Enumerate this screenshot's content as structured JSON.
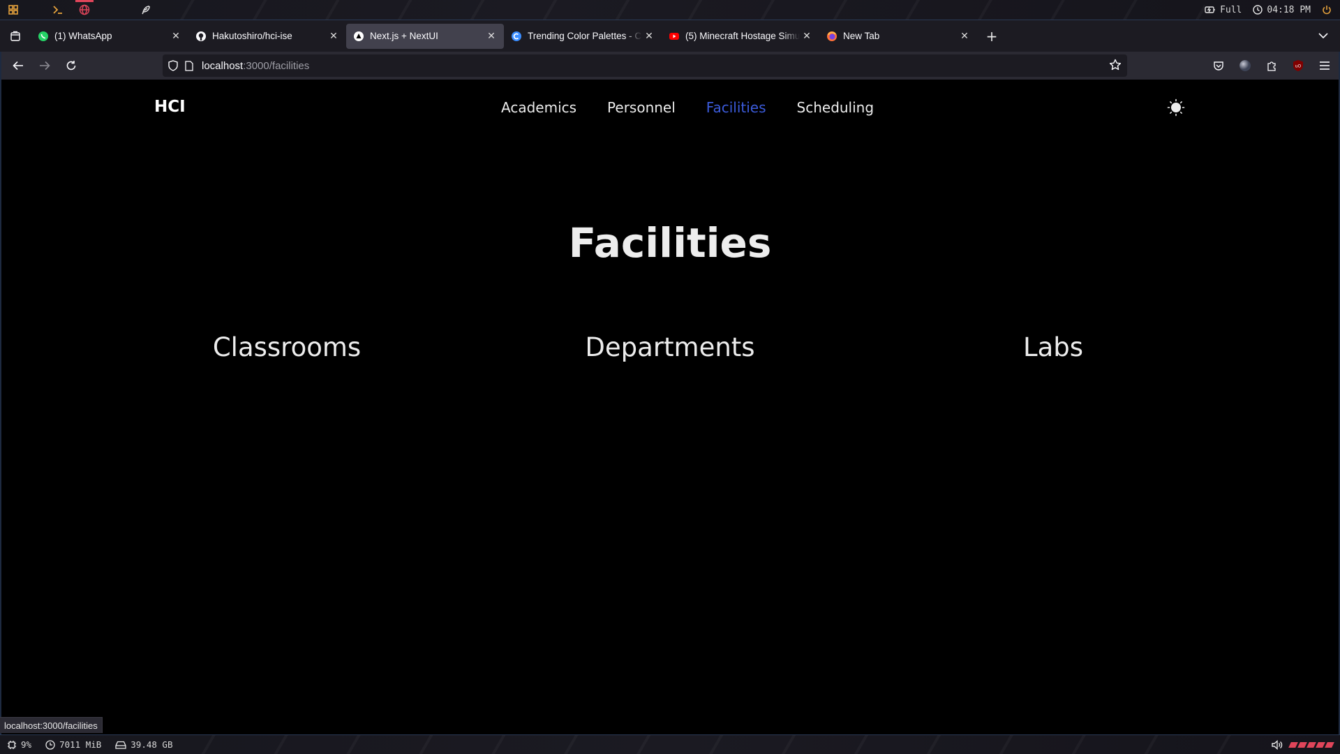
{
  "os_top": {
    "workspaces": [
      "grid",
      "terminal",
      "globe",
      "feather"
    ],
    "power_mode": "Full",
    "clock": "04:18 PM"
  },
  "browser": {
    "tabs": [
      {
        "label": "(1) WhatsApp",
        "icon": "whatsapp-icon",
        "active": false
      },
      {
        "label": "Hakutoshiro/hci-ise",
        "icon": "github-icon",
        "active": false
      },
      {
        "label": "Next.js + NextUI",
        "icon": "nextjs-icon",
        "active": true
      },
      {
        "label": "Trending Color Palettes - C",
        "icon": "coolors-icon",
        "active": false
      },
      {
        "label": "(5) Minecraft Hostage Simu",
        "icon": "youtube-icon",
        "active": false
      },
      {
        "label": "New Tab",
        "icon": "firefox-icon",
        "active": false
      }
    ],
    "url_host": "localhost",
    "url_path": ":3000/facilities",
    "status_url": "localhost:3000/facilities"
  },
  "site": {
    "brand": "HCI",
    "nav": [
      {
        "label": "Academics",
        "active": false
      },
      {
        "label": "Personnel",
        "active": false
      },
      {
        "label": "Facilities",
        "active": true
      },
      {
        "label": "Scheduling",
        "active": false
      }
    ],
    "title": "Facilities",
    "sections": [
      "Classrooms",
      "Departments",
      "Labs"
    ],
    "accent_color": "#3b5bdb"
  },
  "os_bottom": {
    "cpu": "9%",
    "memory": "7011 MiB",
    "disk": "39.48 GB"
  }
}
